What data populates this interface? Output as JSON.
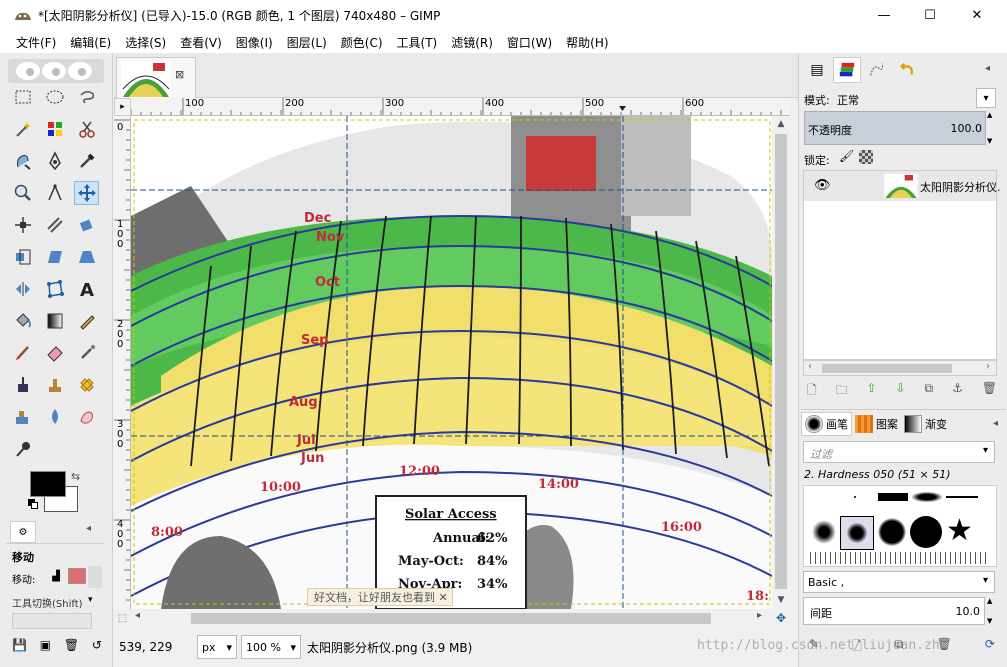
{
  "window": {
    "title": "*[太阳阴影分析仪] (已导入)-15.0 (RGB 颜色, 1 个图层) 740x480 – GIMP",
    "controls": [
      "—",
      "☐",
      "✕"
    ]
  },
  "menubar": [
    "文件(F)",
    "编辑(E)",
    "选择(S)",
    "查看(V)",
    "图像(I)",
    "图层(L)",
    "颜色(C)",
    "工具(T)",
    "滤镜(R)",
    "窗口(W)",
    "帮助(H)"
  ],
  "toolbox": {
    "tool_options_title": "移动",
    "move_label": "移动:",
    "toggle_hint": "工具切换(Shift)"
  },
  "image_tab": {
    "close": "⊠"
  },
  "rulers": {
    "h_ticks": [
      "100",
      "200",
      "300",
      "400",
      "500",
      "600"
    ],
    "v_ticks": [
      [
        "0"
      ],
      [
        "1",
        "0",
        "0"
      ],
      [
        "2",
        "0",
        "0"
      ],
      [
        "3",
        "0",
        "0"
      ],
      [
        "4",
        "0",
        "0"
      ]
    ]
  },
  "image": {
    "months": [
      "Dec",
      "Nov",
      "Oct",
      "Sep",
      "Aug",
      "Jul",
      "Jun"
    ],
    "hours": [
      "8:00",
      "10:00",
      "12:00",
      "14:00",
      "16:00",
      "18:"
    ],
    "solar_box": {
      "title": "Solar Access",
      "rows": [
        {
          "label": "Annual:",
          "value": "62%"
        },
        {
          "label": "May-Oct:",
          "value": "84%"
        },
        {
          "label": "Nov-Apr:",
          "value": "34%"
        }
      ]
    },
    "watermark_popup": "好文档，让好朋友也看到 ✕"
  },
  "statusbar": {
    "coords": "539, 229",
    "unit": "px",
    "zoom": "100 %",
    "filename": "太阳阴影分析仪.png (3.9 MB)"
  },
  "layers": {
    "mode_label": "模式:",
    "mode_value": "正常",
    "opacity_label": "不透明度",
    "opacity_value": "100.0",
    "lock_label": "锁定:",
    "layer_name": "太阳阴影分析仪.",
    "opacity_fraction": 1.0
  },
  "brushes": {
    "tabs": [
      "画笔",
      "图案",
      "渐变"
    ],
    "filter_placeholder": "过滤",
    "brush_name": "2. Hardness 050 (51 × 51)",
    "preset": "Basic ,",
    "spacing_label": "间距",
    "spacing_value": "10.0"
  },
  "url_watermark": "http://blog.csdn.net/liujuan.zhu",
  "colors": {
    "accent": "#9fb3c8",
    "selected_tool": "#cfe3f7",
    "guide": "#1f4d8a"
  }
}
